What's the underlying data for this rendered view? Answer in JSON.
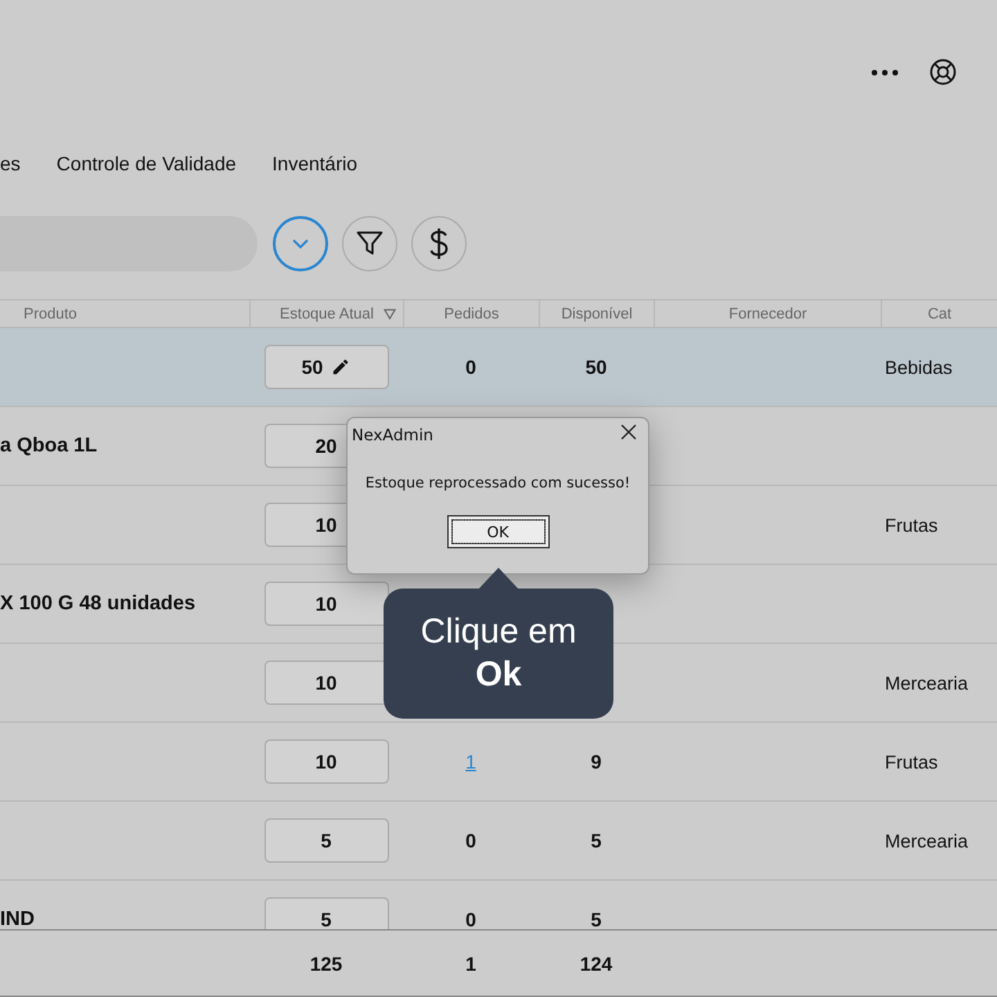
{
  "tabs": [
    "es",
    "Controle de Validade",
    "Inventário"
  ],
  "table": {
    "columns": [
      "Produto",
      "Estoque Atual",
      "Pedidos",
      "Disponível",
      "Fornecedor",
      "Cat"
    ],
    "rows": [
      {
        "selected": true,
        "stock": "50",
        "orders": "0",
        "available": "50",
        "category": "Bebidas"
      },
      {
        "selected": false,
        "product": "a Qboa 1L",
        "stock": "20"
      },
      {
        "selected": false,
        "stock": "10",
        "category": "Frutas"
      },
      {
        "selected": false,
        "product": "X 100 G 48 unidades",
        "stock": "10"
      },
      {
        "selected": false,
        "stock": "10",
        "category": "Mercearia"
      },
      {
        "selected": false,
        "stock": "10",
        "orders": "1",
        "orders_link": true,
        "available": "9",
        "category": "Frutas"
      },
      {
        "selected": false,
        "stock": "5",
        "orders": "0",
        "available": "5",
        "category": "Mercearia"
      },
      {
        "selected": false,
        "product": "IND",
        "stock": "5",
        "orders": "0",
        "available": "5"
      }
    ],
    "totals": {
      "stock": "125",
      "orders": "1",
      "available": "124"
    }
  },
  "dialog": {
    "title": "NexAdmin",
    "message": "Estoque reprocessado com sucesso!",
    "button": "OK"
  },
  "tooltip": "Clique em **Ok**"
}
